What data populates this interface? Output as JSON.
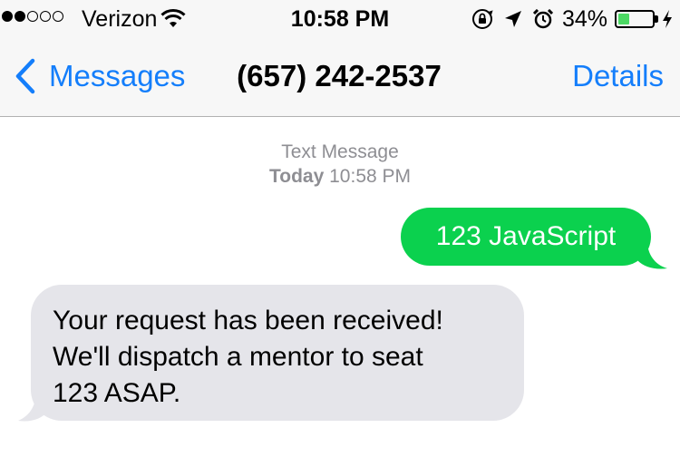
{
  "status_bar": {
    "signal_bars_filled": 2,
    "signal_bars_total": 5,
    "carrier": "Verizon",
    "wifi_icon": "wifi-icon",
    "time": "10:58 PM",
    "orientation_lock_icon": "orientation-lock-icon",
    "location_icon": "location-arrow-icon",
    "alarm_icon": "alarm-clock-icon",
    "battery_percent_text": "34%",
    "battery_level": 0.34,
    "battery_fill_color": "#4cd964",
    "charging_icon": "bolt-icon"
  },
  "nav": {
    "back_label": "Messages",
    "back_icon": "chevron-left-icon",
    "title": "(657) 242-2537",
    "details_label": "Details",
    "accent_color": "#147efb"
  },
  "conversation": {
    "service_label": "Text Message",
    "day_label": "Today",
    "time_label": "10:58 PM",
    "messages": [
      {
        "direction": "outgoing",
        "text": "123 JavaScript",
        "bubble_color": "#0bd14e"
      },
      {
        "direction": "incoming",
        "text": "Your request has been received!\nWe'll dispatch a mentor to seat\n123 ASAP.",
        "bubble_color": "#e5e5ea"
      }
    ]
  }
}
